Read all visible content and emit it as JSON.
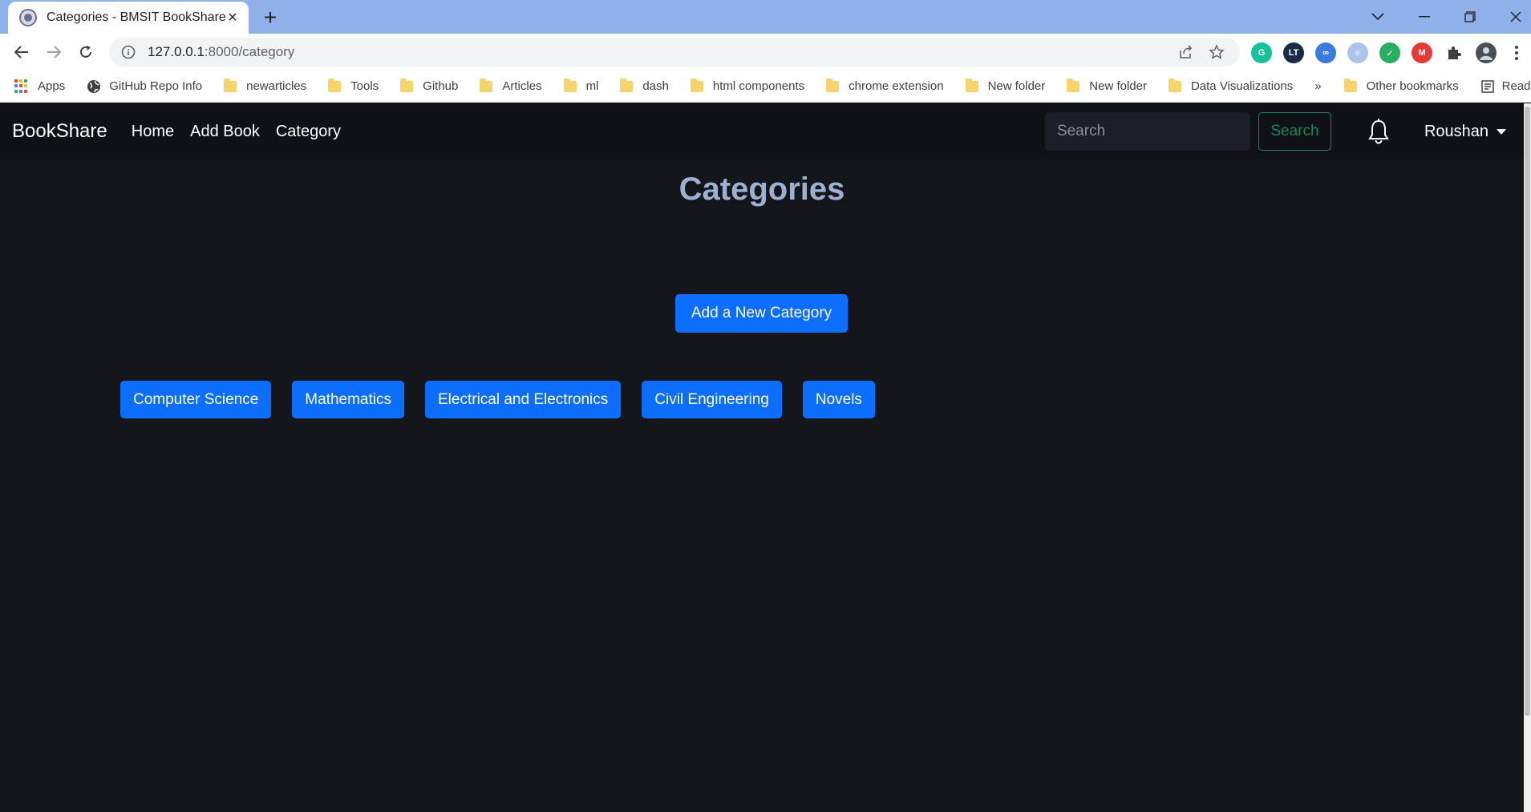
{
  "browser": {
    "tab_title": "Categories - BMSIT BookShare",
    "url_host": "127.0.0.1",
    "url_rest": ":8000/category",
    "bookmarks": [
      {
        "label": "Apps",
        "type": "apps"
      },
      {
        "label": "GitHub Repo Info",
        "type": "globe"
      },
      {
        "label": "newarticles",
        "type": "folder"
      },
      {
        "label": "Tools",
        "type": "folder"
      },
      {
        "label": "Github",
        "type": "folder"
      },
      {
        "label": "Articles",
        "type": "folder"
      },
      {
        "label": "ml",
        "type": "folder"
      },
      {
        "label": "dash",
        "type": "folder"
      },
      {
        "label": "html components",
        "type": "folder"
      },
      {
        "label": "chrome extension",
        "type": "folder"
      },
      {
        "label": "New folder",
        "type": "folder"
      },
      {
        "label": "New folder",
        "type": "folder"
      },
      {
        "label": "Data Visualizations",
        "type": "folder"
      }
    ],
    "overflow_label": "»",
    "other_bookmarks": "Other bookmarks",
    "reading_list": "Reading list",
    "extensions": [
      {
        "name": "grammarly-extension-icon",
        "color": "#15c39a",
        "text": "G"
      },
      {
        "name": "languagetool-extension-icon",
        "color": "#1a2b49",
        "text": "LT"
      },
      {
        "name": "infinity-extension-icon",
        "color": "#3b7be0",
        "text": "∞"
      },
      {
        "name": "react-devtools-extension-icon",
        "color": "#a9c6ea",
        "text": "⚛"
      },
      {
        "name": "shield-extension-icon",
        "color": "#27ae60",
        "text": "✓"
      },
      {
        "name": "mail-extension-icon",
        "color": "#e53935",
        "text": "M"
      }
    ]
  },
  "navbar": {
    "brand": "BookShare",
    "links": [
      "Home",
      "Add Book",
      "Category"
    ],
    "search_placeholder": "Search",
    "search_button": "Search",
    "user": "Roushan"
  },
  "main": {
    "title": "Categories",
    "add_button": "Add a New Category",
    "categories": [
      "Computer Science",
      "Mathematics",
      "Electrical and Electronics",
      "Civil Engineering",
      "Novels"
    ]
  },
  "colors": {
    "primary": "#0d6efd",
    "success": "#198754",
    "background": "#14161c",
    "heading": "#9bb1cf"
  }
}
